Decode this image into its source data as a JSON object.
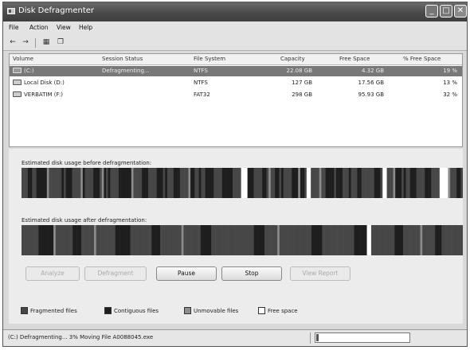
{
  "window": {
    "title": "Disk Defragmenter"
  },
  "menu": [
    "File",
    "Action",
    "View",
    "Help"
  ],
  "toolbar": {
    "icons": [
      "back-arrow-icon",
      "forward-arrow-icon",
      "properties-icon",
      "help-book-icon"
    ]
  },
  "volumes": {
    "columns": [
      "Volume",
      "Session Status",
      "File System",
      "Capacity",
      "Free Space",
      "% Free Space"
    ],
    "rows": [
      {
        "volume": "(C:)",
        "status": "Defragmenting...",
        "fs": "NTFS",
        "capacity": "22.08 GB",
        "free": "4.32 GB",
        "pct": "19 %",
        "selected": true
      },
      {
        "volume": "Local Disk (D:)",
        "status": "",
        "fs": "NTFS",
        "capacity": "127 GB",
        "free": "17.56 GB",
        "pct": "13 %",
        "selected": false
      },
      {
        "volume": "VERBATIM (F:)",
        "status": "",
        "fs": "FAT32",
        "capacity": "298 GB",
        "free": "95.93 GB",
        "pct": "32 %",
        "selected": false
      }
    ]
  },
  "before_label": "Estimated disk usage before defragmentation:",
  "after_label": "Estimated disk usage after defragmentation:",
  "disk_map_before": "FFFCCFFCCCCCUFFFFFFCFCCCFFFFUCFFFFCCCFUCFCFFFFCCCCCCUFFFFCCCFFFFCCCFCFFFCCCFFFFUCCFFCFFCCCCFFFFCCCCCFFFF...CCCFFFFCCFUFFCCFCFFFFCCCUCCF..FFFFUFFCCCCFCCCFFFCFFFCCFFFFFFCCCF..FFFUCCCFCFFCCCFFFFCCCFFFF....UFFFCCF",
  "disk_map_after": "FFFFFFFFCCCCCCCUFFFFFFFFCCCCFFFFFFUFFFFFFFFFCCCCCCCFFFFFFFFFFCCCCFFFFFFFFFFUFFFFFFFFCCCCCFFFFFFFFFFFFFFFFFFFFCCCCCFFFFFFUFFFFFFFFFFFFFFFCCCCCFFFFFFFFFFFFFFFCCCCCC..FFFFFFFFFFFCCCCFFFFFFFFUFFFFFFCCCFFFFFFFFFF",
  "buttons": [
    {
      "label": "Analyze",
      "enabled": false
    },
    {
      "label": "Defragment",
      "enabled": false
    },
    {
      "label": "Pause",
      "enabled": true
    },
    {
      "label": "Stop",
      "enabled": true
    },
    {
      "label": "View Report",
      "enabled": false
    }
  ],
  "legend": [
    {
      "label": "Fragmented files",
      "color": "#474747"
    },
    {
      "label": "Contiguous files",
      "color": "#1e1e1e"
    },
    {
      "label": "Unmovable files",
      "color": "#8c8c8c"
    },
    {
      "label": "Free space",
      "color": "#ffffff"
    }
  ],
  "colors": {
    "F": "#474747",
    "C": "#1e1e1e",
    "U": "#8c8c8c",
    ".": "#ffffff"
  },
  "status": {
    "text": "(C:) Defragmenting... 3% Moving File A0088045.exe",
    "progress": 0.03
  }
}
